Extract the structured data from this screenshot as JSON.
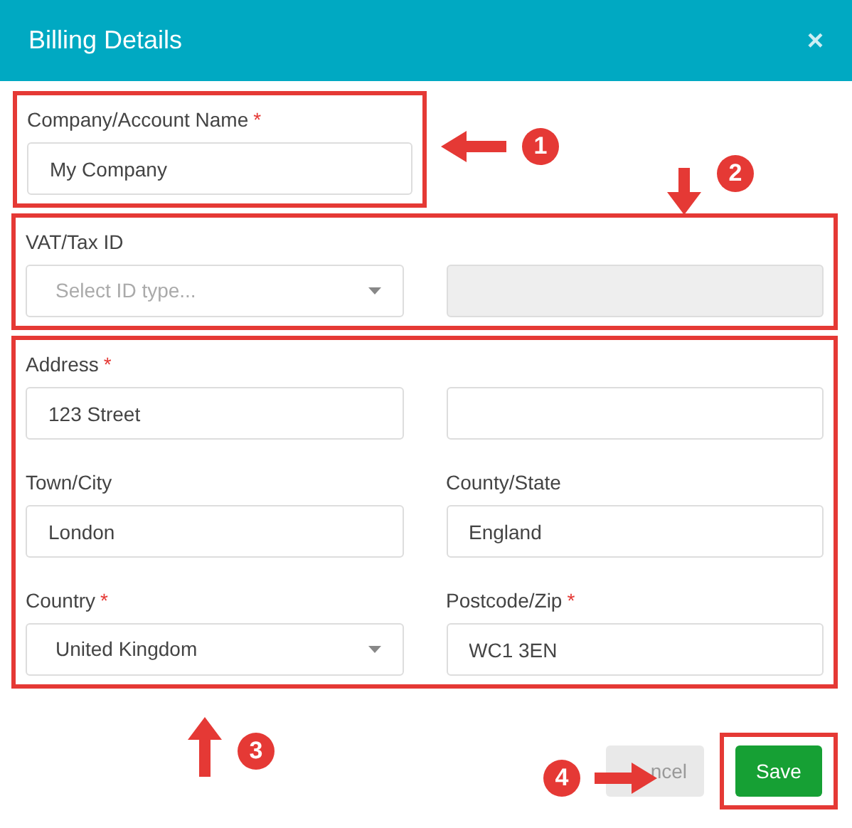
{
  "dialog": {
    "title": "Billing Details",
    "close": "×"
  },
  "sections": [
    {
      "highlighted": true,
      "fields": [
        {
          "label": "Company/Account Name",
          "marker": "*",
          "kind": "text",
          "value": "My Company",
          "disabled": false
        }
      ]
    },
    {
      "highlighted": true,
      "fields": [
        {
          "label": "VAT/Tax ID",
          "kind": "select",
          "placeholder": "Select ID type...",
          "disabled": false
        },
        {
          "kind": "text",
          "disabled": true
        }
      ]
    },
    {
      "highlighted": true,
      "fields": [
        {
          "label": "Address",
          "marker": "*",
          "kind": "text",
          "value": "123 Street",
          "disabled": false
        },
        {
          "kind": "text",
          "disabled": false
        },
        {
          "label": "Town/City",
          "kind": "text",
          "value": "London",
          "disabled": false
        },
        {
          "label": "County/State",
          "kind": "text",
          "value": "England",
          "disabled": false
        },
        {
          "label": "Country",
          "marker": "*",
          "kind": "select",
          "value": "United Kingdom",
          "disabled": false
        },
        {
          "label": "Postcode/Zip",
          "marker": "*",
          "kind": "text",
          "value": "WC1 3EN",
          "disabled": false
        }
      ]
    }
  ],
  "buttons": [
    {
      "label": "ncel",
      "kind": "secondary",
      "highlighted": false
    },
    {
      "label": "Save",
      "kind": "primary",
      "highlighted": true
    }
  ],
  "annotations": [
    {
      "number": "1"
    },
    {
      "number": "2"
    },
    {
      "number": "3"
    },
    {
      "number": "4"
    }
  ]
}
